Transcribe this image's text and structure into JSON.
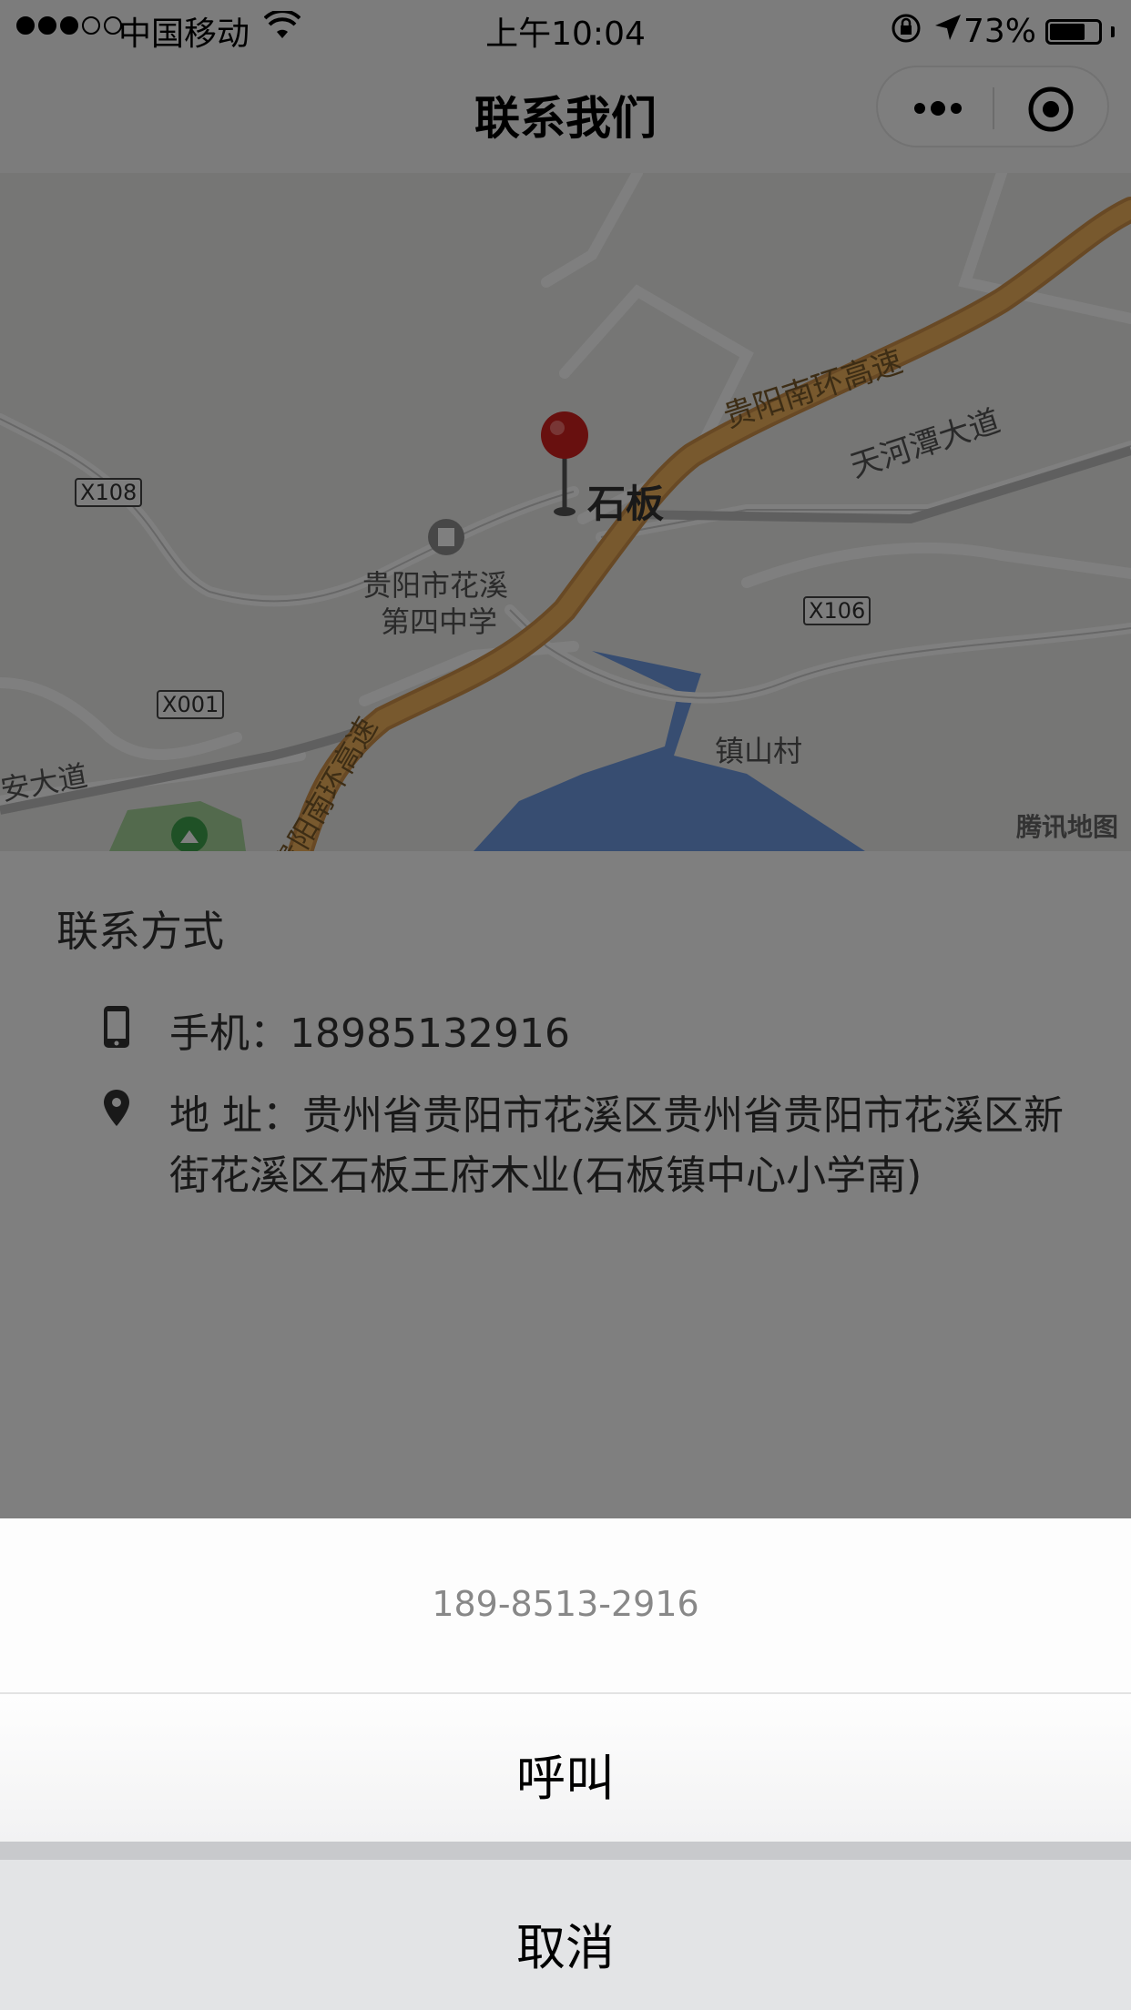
{
  "status_bar": {
    "carrier": "中国移动",
    "time": "上午10:04",
    "battery_text": "73%",
    "battery_level": 0.73
  },
  "nav": {
    "title": "联系我们",
    "more_icon": "more-dots-icon",
    "close_icon": "target-circle-icon"
  },
  "map": {
    "labels": {
      "highway": "贵阳南环高速",
      "highway_vertical": "贵阳南环高速",
      "tianhetan": "天河潭大道",
      "shiban": "石板",
      "school_line1": "贵阳市花溪",
      "school_line2": "第四中学",
      "zhenshan": "镇山村",
      "andadao": "安大道"
    },
    "badges": {
      "x108": "X108",
      "x106": "X106",
      "x001": "X001"
    },
    "logo": "腾讯地图",
    "colors": {
      "highway": "#f0b35c",
      "water": "#6e9ae3",
      "park": "#a6d49a",
      "road": "#ffffff",
      "marker": "#d0201e"
    }
  },
  "contact": {
    "title": "联系方式",
    "phone_text": "手机：18985132916",
    "address_text": "地 址：贵州省贵阳市花溪区贵州省贵阳市花溪区新街花溪区石板王府木业(石板镇中心小学南)"
  },
  "action_sheet": {
    "phone_display": "189-8513-2916",
    "call_label": "呼叫",
    "cancel_label": "取消"
  }
}
